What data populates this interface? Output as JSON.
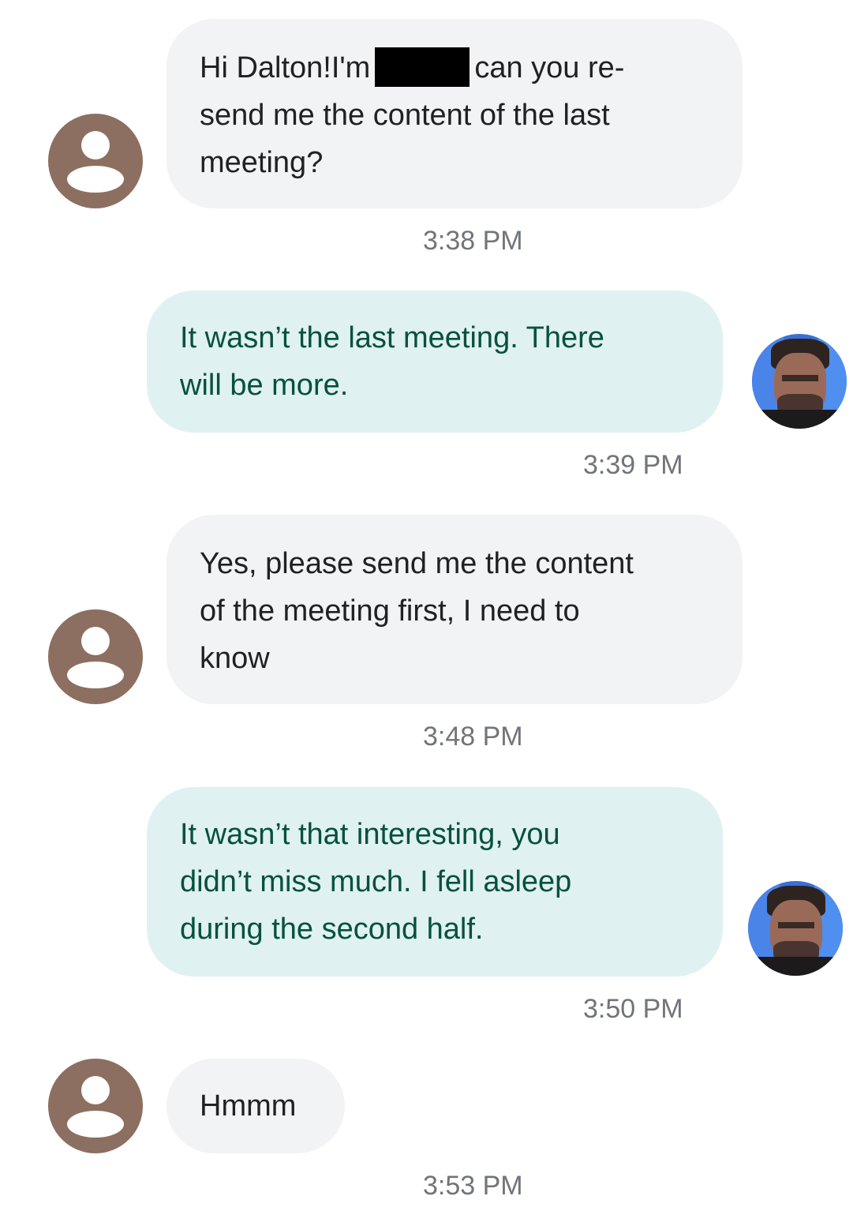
{
  "messages": [
    {
      "direction": "incoming",
      "lines": [
        "Hi Dalton!I'm",
        "can you re-",
        "send me the content of the last",
        "meeting?"
      ],
      "redacted": true,
      "time": "3:38 PM"
    },
    {
      "direction": "outgoing",
      "lines": [
        "It wasn’t the last meeting.  There",
        "will be more."
      ],
      "time": "3:39 PM"
    },
    {
      "direction": "incoming",
      "lines": [
        "Yes, please send me the content",
        "of the meeting first, I need to",
        "know"
      ],
      "time": "3:48 PM"
    },
    {
      "direction": "outgoing",
      "lines": [
        "It wasn’t that interesting, you",
        "didn’t miss much.  I fell asleep",
        "during the second half."
      ],
      "time": "3:50 PM"
    },
    {
      "direction": "incoming",
      "lines": [
        "Hmmm"
      ],
      "time": "3:53 PM"
    }
  ],
  "colors": {
    "incoming_bubble": "#f1f3f4",
    "incoming_text": "#202124",
    "outgoing_bubble": "#e0f1f1",
    "outgoing_text": "#05513e",
    "timestamp": "#70757a",
    "contact_avatar": "#8c6f60"
  },
  "icons": {
    "contact_avatar": "person-icon",
    "own_avatar": "profile-photo"
  }
}
